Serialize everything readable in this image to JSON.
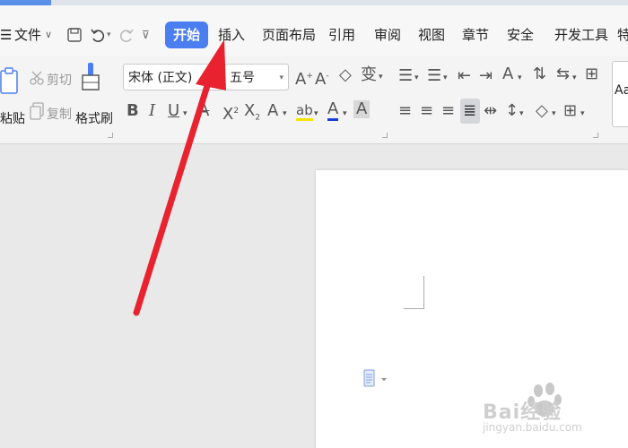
{
  "menu": {
    "file_label": "文件",
    "tabs": [
      "开始",
      "插入",
      "页面布局",
      "引用",
      "审阅",
      "视图",
      "章节",
      "安全",
      "开发工具",
      "特"
    ]
  },
  "clipboard": {
    "paste_label": "粘贴",
    "cut_label": "剪切",
    "copy_label": "复制",
    "format_painter_label": "格式刷"
  },
  "font": {
    "family": "宋体 (正文)",
    "size": "五号"
  },
  "styles": {
    "preview": "Aa"
  },
  "watermark": {
    "text": "Bai经验",
    "url": "jingyan.baidu.com"
  },
  "colors": {
    "accent": "#4b7ef0",
    "arrow": "#e8232f",
    "highlight": "#f2e600",
    "font_color": "#1a3fd6"
  }
}
